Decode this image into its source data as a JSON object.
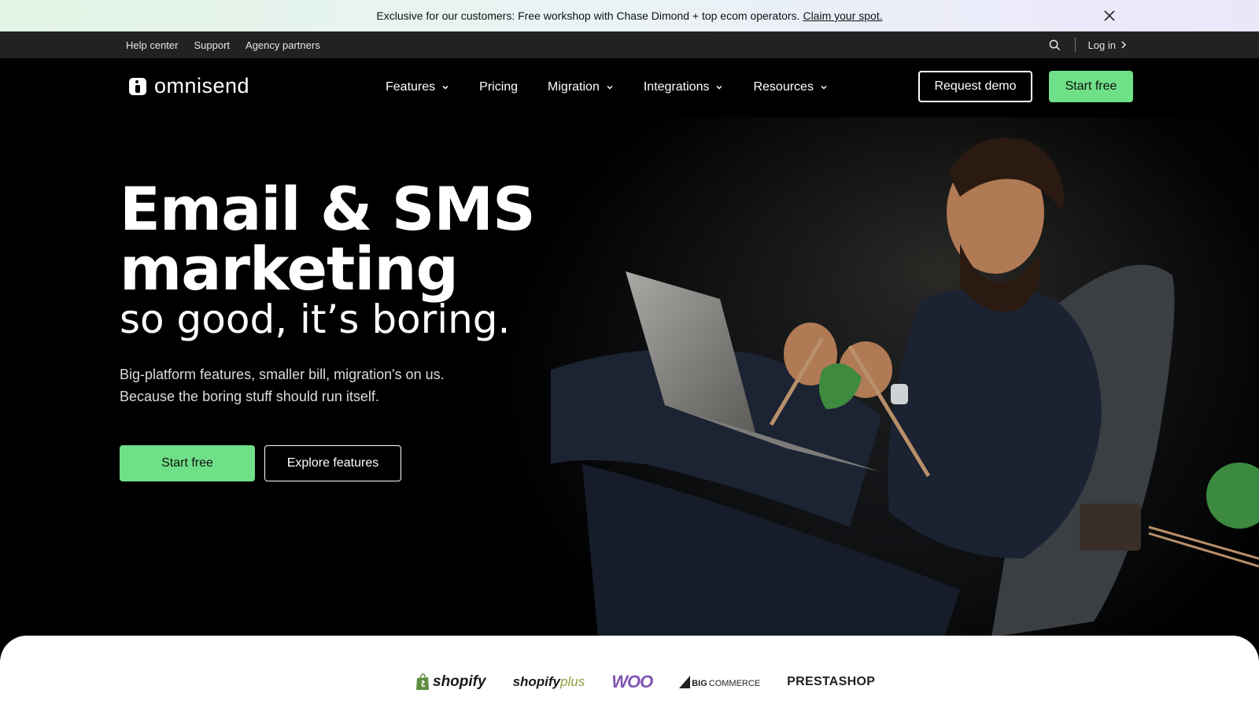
{
  "announcement": {
    "text": "Exclusive for our customers: Free workshop with Chase Dimond + top ecom operators.",
    "link": "Claim your spot."
  },
  "utility": {
    "links": [
      "Help center",
      "Support",
      "Agency partners"
    ],
    "login": "Log in"
  },
  "nav": {
    "logo": "omnisend",
    "menu": [
      "Features",
      "Pricing",
      "Migration",
      "Integrations",
      "Resources"
    ],
    "request_demo": "Request demo",
    "start_free": "Start free"
  },
  "hero": {
    "headline_line1": "Email & SMS",
    "headline_line2": "marketing",
    "tagline": "so good, it’s boring.",
    "sub_line1": "Big-platform features, smaller bill, migration's on us.",
    "sub_line2": "Because the boring stuff should run itself.",
    "cta_primary": "Start free",
    "cta_secondary": "Explore features"
  },
  "platforms": {
    "shopify": "shopify",
    "shopify_plus_a": "shopify",
    "shopify_plus_b": "plus",
    "woo": "WOO",
    "bigcommerce_a": "BIG",
    "bigcommerce_b": "COMMERCE",
    "prestashop": "PRESTASHOP"
  },
  "colors": {
    "accent_green": "#6fe087",
    "background": "#000000",
    "woo_purple": "#7f54b3"
  }
}
